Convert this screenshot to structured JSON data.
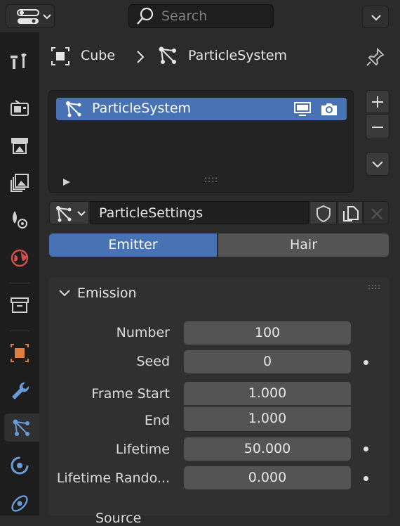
{
  "header": {
    "search_placeholder": "Search"
  },
  "breadcrumb": {
    "object": "Cube",
    "separator": "›",
    "particle_system": "ParticleSystem"
  },
  "particle_list": {
    "items": [
      {
        "label": "ParticleSystem",
        "selected": true
      }
    ],
    "grip": "::::"
  },
  "settings": {
    "name": "ParticleSettings"
  },
  "type_tabs": [
    {
      "label": "Emitter",
      "active": true
    },
    {
      "label": "Hair",
      "active": false
    }
  ],
  "emission": {
    "title": "Emission",
    "fields": [
      {
        "label": "Number",
        "value": "100",
        "dot": false
      },
      {
        "label": "Seed",
        "value": "0",
        "dot": true
      },
      {
        "label": "Frame Start",
        "value": "1.000",
        "dot": false
      },
      {
        "label": "End",
        "value": "1.000",
        "dot": false
      },
      {
        "label": "Lifetime",
        "value": "50.000",
        "dot": true
      },
      {
        "label": "Lifetime Rando...",
        "value": "0.000",
        "dot": true
      }
    ],
    "next_label": "Source"
  },
  "colors": {
    "accent": "#4772b3",
    "field": "#545454",
    "panel": "#303030",
    "sidebar": "#1d1d1d"
  }
}
